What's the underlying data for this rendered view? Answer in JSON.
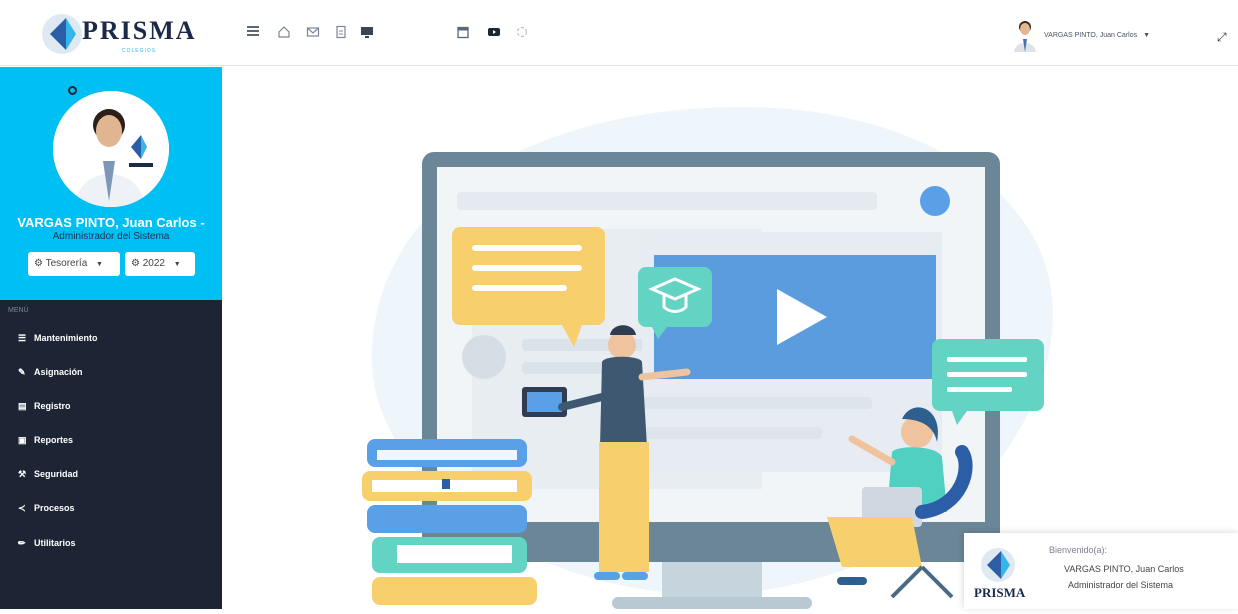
{
  "brand": {
    "name": "PRISMA",
    "sub": "COLEGIOS"
  },
  "toolbar": {
    "icons": [
      "menu-icon",
      "home-icon",
      "mail-icon",
      "document-icon",
      "monitor-icon",
      "calendar-icon",
      "video-icon",
      "refresh-icon"
    ]
  },
  "user": {
    "name": "VARGAS PINTO, Juan Carlos"
  },
  "sidebar": {
    "profile_name": "VARGAS PINTO, Juan Carlos",
    "profile_role": "Administrador del Sistema",
    "area_select": "Tesorería",
    "year_select": "2022",
    "menu_header": "MENÚ",
    "items": [
      {
        "label": "Mantenimiento",
        "icon": "list-icon"
      },
      {
        "label": "Asignación",
        "icon": "edit-icon"
      },
      {
        "label": "Registro",
        "icon": "id-card-icon"
      },
      {
        "label": "Reportes",
        "icon": "file-icon"
      },
      {
        "label": "Seguridad",
        "icon": "wrench-icon"
      },
      {
        "label": "Procesos",
        "icon": "share-icon"
      },
      {
        "label": "Utilitarios",
        "icon": "pencil-icon"
      }
    ]
  },
  "welcome": {
    "title": "Bienvenido(a):",
    "name": "VARGAS PINTO, Juan Carlos",
    "role": "Administrador del Sistema",
    "logo_text": "PRISMA"
  },
  "colors": {
    "sidebar_dark": "#1d2535",
    "accent_cyan": "#00bff3",
    "brand_navy": "#1c2a4a"
  }
}
